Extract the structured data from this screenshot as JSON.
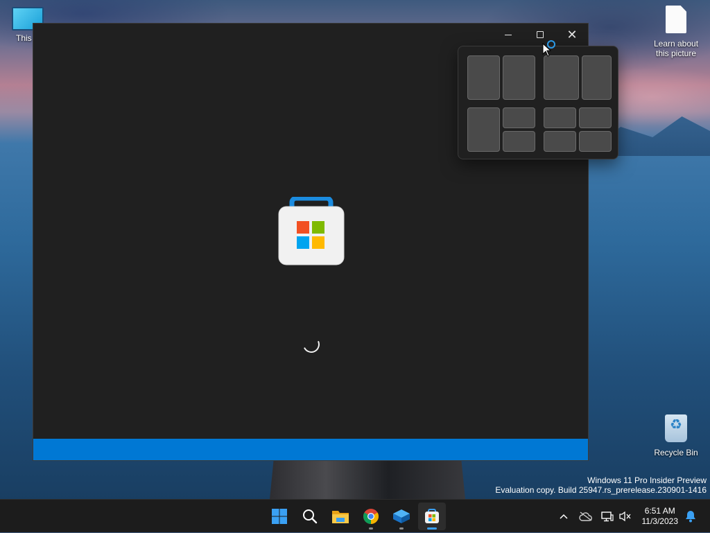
{
  "desktop": {
    "icons": [
      {
        "label": "This PC",
        "visible_label": "This P"
      },
      {
        "label": "Learn about this picture"
      },
      {
        "label": "Recycle Bin"
      }
    ],
    "watermark": {
      "line1": "Windows 11 Pro Insider Preview",
      "line2": "Evaluation copy. Build 25947.rs_prerelease.230901-1416"
    }
  },
  "window": {
    "app": "Microsoft Store",
    "state": "loading",
    "controls": [
      "minimize-icon",
      "maximize-icon",
      "close-icon"
    ],
    "accent_color": "#0078d4",
    "background_color": "#202020"
  },
  "snap_layouts": {
    "layouts": [
      "two-columns-equal",
      "two-columns-wide-left",
      "left-column-and-right-stack",
      "four-quadrants"
    ]
  },
  "taskbar": {
    "items": [
      {
        "name": "start",
        "icon": "windows-logo-icon"
      },
      {
        "name": "search",
        "icon": "search-icon"
      },
      {
        "name": "file-explorer",
        "icon": "folder-icon"
      },
      {
        "name": "chrome",
        "icon": "chrome-icon"
      },
      {
        "name": "app",
        "icon": "blue-box-icon"
      },
      {
        "name": "microsoft-store",
        "icon": "store-icon",
        "active": true
      }
    ],
    "tray": [
      "chevron-up-icon",
      "onedrive-cloud-icon",
      "network-icon",
      "volume-muted-icon"
    ],
    "clock": {
      "time": "6:51 AM",
      "date": "11/3/2023"
    }
  }
}
